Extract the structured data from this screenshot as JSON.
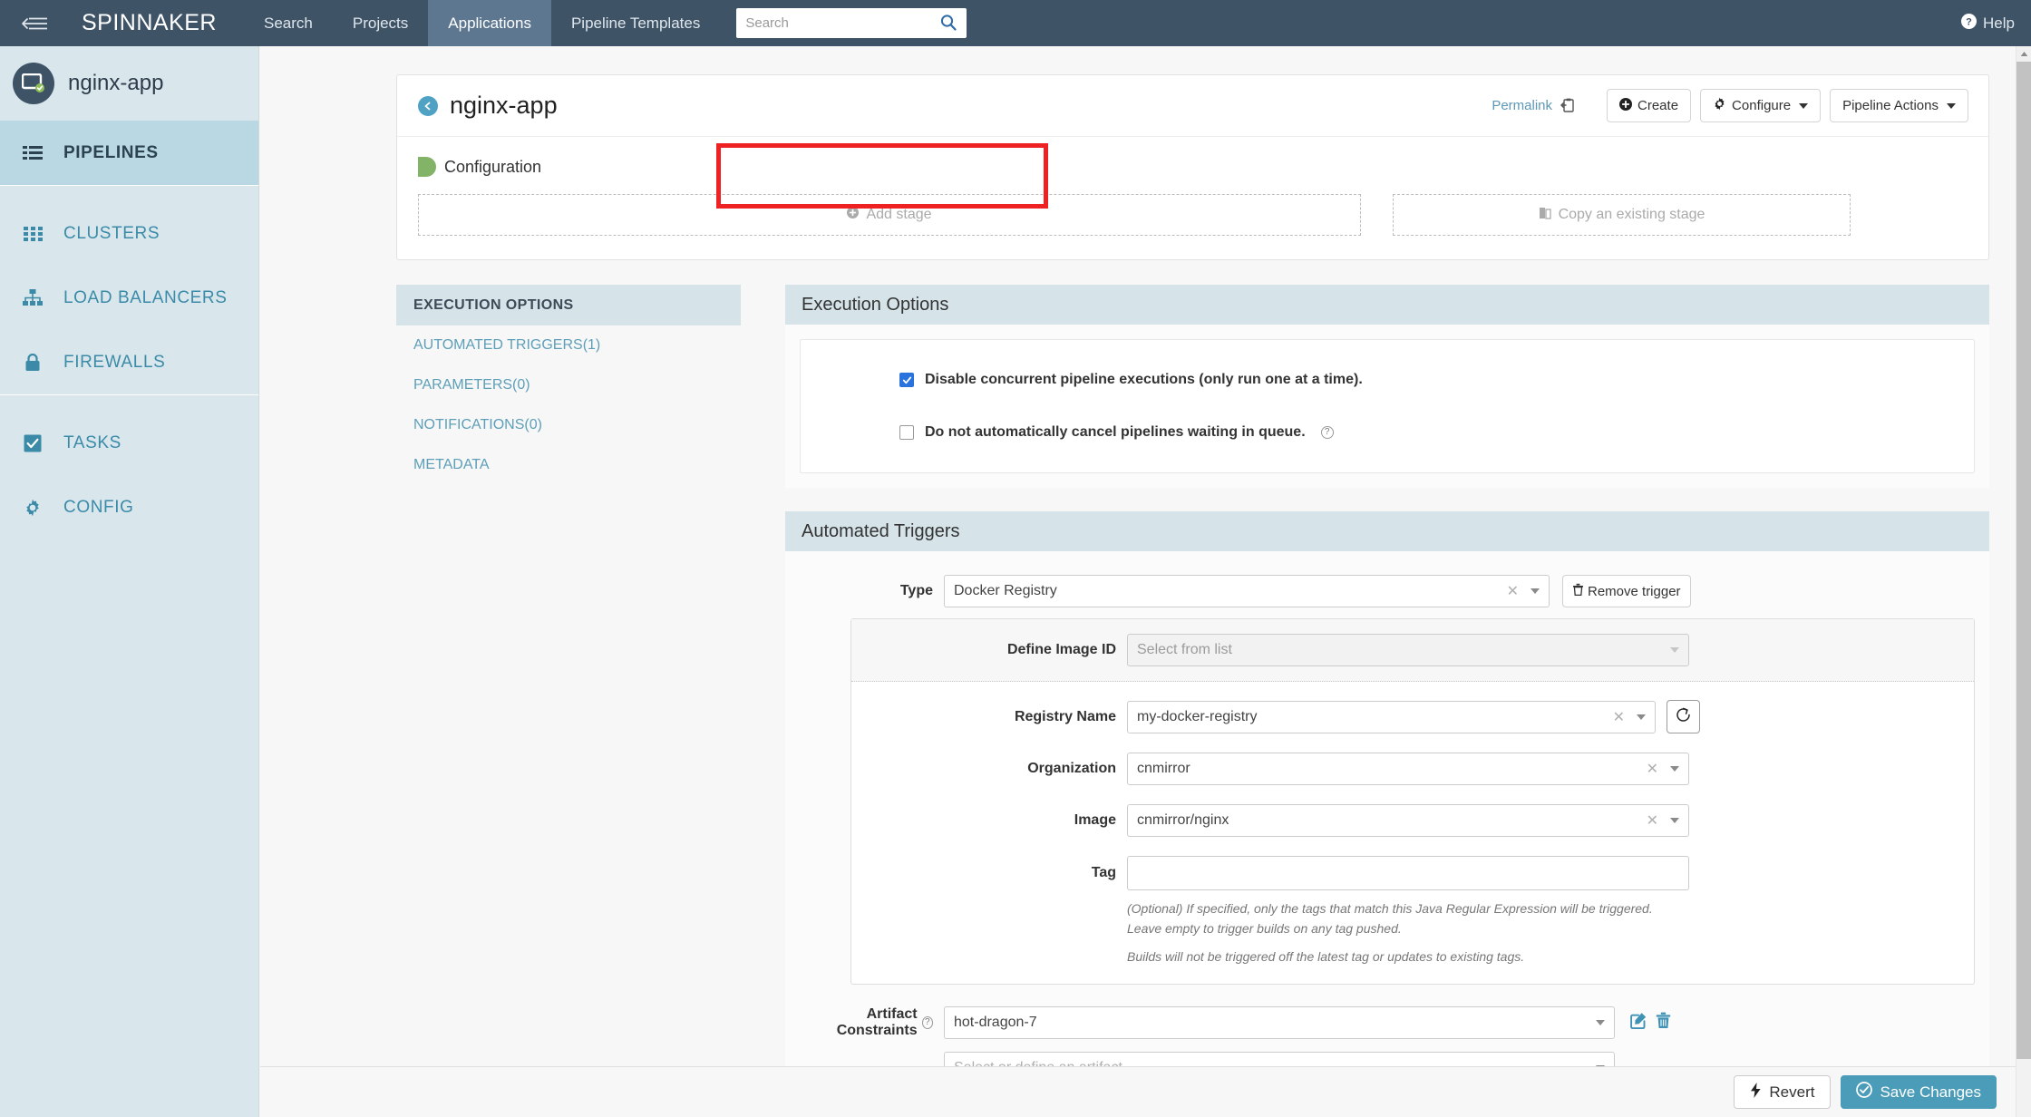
{
  "topnav": {
    "brand": "SPINNAKER",
    "links": [
      {
        "label": "Search",
        "active": false
      },
      {
        "label": "Projects",
        "active": false
      },
      {
        "label": "Applications",
        "active": true
      },
      {
        "label": "Pipeline Templates",
        "active": false
      }
    ],
    "search_placeholder": "Search",
    "search_value": "",
    "help_label": "Help"
  },
  "sidebar": {
    "app_name": "nginx-app",
    "items": [
      {
        "label": "PIPELINES",
        "icon": "list-icon",
        "active": true
      },
      {
        "label": "CLUSTERS",
        "icon": "grid-icon",
        "active": false
      },
      {
        "label": "LOAD BALANCERS",
        "icon": "sitemap-icon",
        "active": false
      },
      {
        "label": "FIREWALLS",
        "icon": "lock-icon",
        "active": false
      },
      {
        "label": "TASKS",
        "icon": "checkbox-icon",
        "active": false
      },
      {
        "label": "CONFIG",
        "icon": "gear-icon",
        "active": false
      }
    ]
  },
  "pipeline_header": {
    "title": "nginx-app",
    "permalink_label": "Permalink",
    "buttons": [
      {
        "label": "Create",
        "icon": "plus-circle-icon",
        "caret": false
      },
      {
        "label": "Configure",
        "icon": "gear-icon",
        "caret": true
      },
      {
        "label": "Pipeline Actions",
        "icon": "",
        "caret": true
      }
    ]
  },
  "stage_strip": {
    "configuration_label": "Configuration",
    "add_stage_label": "Add stage",
    "copy_stage_label": "Copy an existing stage"
  },
  "left_nav": {
    "header": "EXECUTION OPTIONS",
    "items": [
      {
        "label": "AUTOMATED TRIGGERS(1)"
      },
      {
        "label": "PARAMETERS(0)"
      },
      {
        "label": "NOTIFICATIONS(0)"
      },
      {
        "label": "METADATA"
      }
    ]
  },
  "execution_options": {
    "heading": "Execution Options",
    "checkboxes": [
      {
        "label": "Disable concurrent pipeline executions (only run one at a time).",
        "checked": true,
        "help": false
      },
      {
        "label": "Do not automatically cancel pipelines waiting in queue.",
        "checked": false,
        "help": true
      }
    ]
  },
  "automated_triggers": {
    "heading": "Automated Triggers",
    "type_label": "Type",
    "type_value": "Docker Registry",
    "remove_trigger_label": "Remove trigger",
    "fields": [
      {
        "label": "Define Image ID",
        "value": "Select from list",
        "disabled": true,
        "clear": false
      },
      {
        "label": "Registry Name",
        "value": "my-docker-registry",
        "disabled": false,
        "clear": true,
        "refresh": true
      },
      {
        "label": "Organization",
        "value": "cnmirror",
        "disabled": false,
        "clear": true
      },
      {
        "label": "Image",
        "value": "cnmirror/nginx",
        "disabled": false,
        "clear": true
      }
    ],
    "tag_label": "Tag",
    "tag_value": "",
    "tag_help_1": "(Optional) If specified, only the tags that match this Java Regular Expression will be triggered. Leave empty to trigger builds on any tag pushed.",
    "tag_help_2": "Builds will not be triggered off the latest tag or updates to existing tags.",
    "artifact_constraints_label": "Artifact Constraints",
    "artifact_value": "hot-dragon-7",
    "artifact_placeholder": "Select or define an artifact..."
  },
  "bottom_bar": {
    "revert_label": "Revert",
    "save_label": "Save Changes"
  },
  "colors": {
    "nav_bg": "#3f5367",
    "nav_active": "#5d7791",
    "sidebar_bg": "#d9e7ed",
    "sidebar_active": "#b9d8e4",
    "link": "#3b8ba8",
    "section_head": "#d6e4ea",
    "save_btn": "#4a9cb8",
    "highlight_box": "#ee2222",
    "stage_green": "#82b366",
    "checkbox_checked": "#2a72de"
  }
}
